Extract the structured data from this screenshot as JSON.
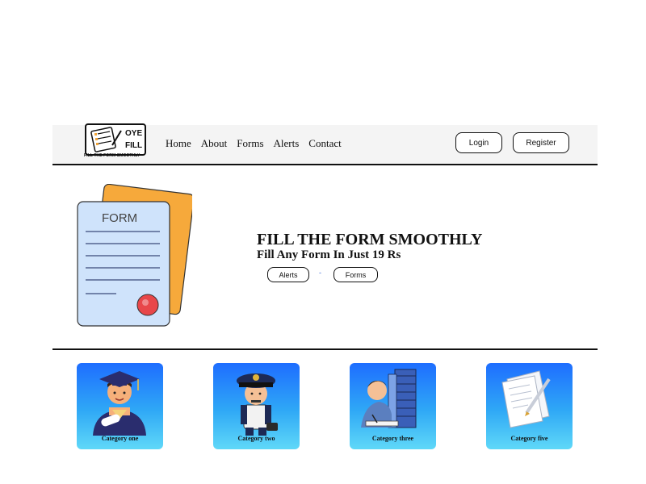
{
  "logo": {
    "line1": "OYE",
    "line2": "FILL",
    "tagline": "FILL THE FORM SMOOTHLY"
  },
  "nav": {
    "links": [
      "Home",
      "About",
      "Forms",
      "Alerts",
      "Contact"
    ]
  },
  "auth": {
    "login": "Login",
    "register": "Register"
  },
  "hero": {
    "image_label": "FORM",
    "title": "FILL THE FORM SMOOTHLY",
    "subtitle": "Fill Any Form In Just 19 Rs",
    "buttons": [
      "Alerts",
      "Forms"
    ],
    "separator": "-"
  },
  "categories": [
    {
      "label": "Category one",
      "icon": "graduate-icon"
    },
    {
      "label": "Category two",
      "icon": "police-officer-icon"
    },
    {
      "label": "Category three",
      "icon": "paperwork-icon"
    },
    {
      "label": "Category five",
      "icon": "document-pen-icon"
    }
  ],
  "colors": {
    "card_top": "#1e6dff",
    "card_bottom": "#5fd8f8",
    "form_front": "#cfe3fb",
    "form_back": "#f6a93b",
    "seal": "#e8474a"
  }
}
